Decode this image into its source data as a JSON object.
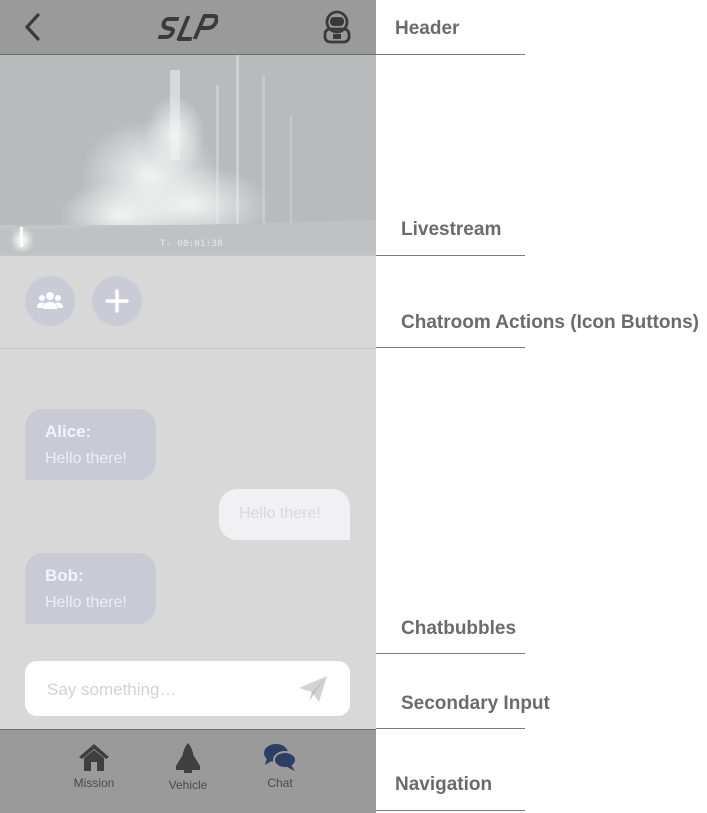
{
  "header": {
    "back_icon": "chevron-left-icon",
    "logo_text": "SLP",
    "profile_icon": "astronaut-icon"
  },
  "livestream": {
    "timer": "T- 00:01:38"
  },
  "chatroom_actions": {
    "members_icon": "users-icon",
    "add_icon": "plus-icon"
  },
  "messages": [
    {
      "sender": "Alice:",
      "text": "Hello there!",
      "side": "left"
    },
    {
      "sender": "",
      "text": "Hello there!",
      "side": "right"
    },
    {
      "sender": "Bob:",
      "text": "Hello there!",
      "side": "left"
    }
  ],
  "input": {
    "placeholder": "Say something…",
    "send_icon": "paper-plane-icon"
  },
  "nav": {
    "items": [
      {
        "label": "Mission",
        "icon": "house-icon"
      },
      {
        "label": "Vehicle",
        "icon": "shuttle-icon"
      },
      {
        "label": "Chat",
        "icon": "chat-bubbles-icon",
        "active": true
      }
    ]
  },
  "annotations": {
    "header": "Header",
    "livestream": "Livestream",
    "chatroom_actions": "Chatroom Actions (Icon Buttons)",
    "chatbubbles": "Chatbubbles",
    "secondary_input": "Secondary Input",
    "navigation": "Navigation"
  },
  "colors": {
    "header_bg": "#9a9a9a",
    "screen_bg": "#d8d8d8",
    "bubble_left": "#c8cad6",
    "bubble_right": "#f1f1f4",
    "nav_active": "#2d3e63"
  }
}
